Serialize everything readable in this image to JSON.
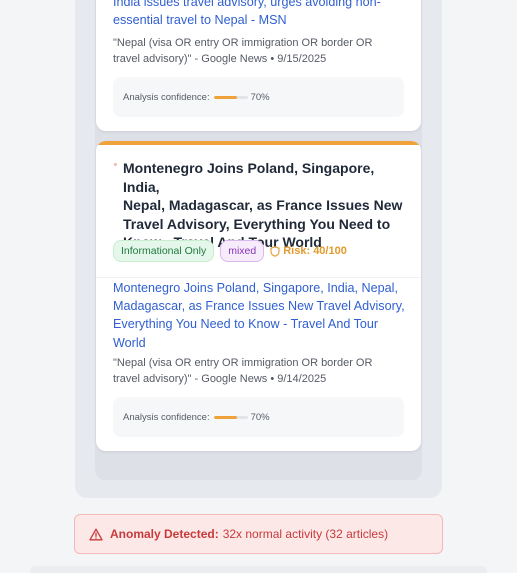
{
  "card1": {
    "link": "India issues travel advisory, urges avoiding non-essential travel to Nepal - MSN",
    "link_line1": "India issues travel advisory, urges avoiding non-",
    "link_line2": "essential travel to Nepal - MSN",
    "source_line1": "\"Nepal (visa OR entry OR immigration OR border OR",
    "source_line2": "travel advisory)\" - Google News • 9/15/2025",
    "confidence_label": "Analysis confidence:",
    "confidence_value": "70%",
    "confidence_fraction": 0.7
  },
  "card2": {
    "title_line1": "Montenegro Joins Poland, Singapore, India,",
    "title_line2": "Nepal, Madagascar, as France Issues New",
    "title_line3": "Travel Advisory, Everything You Need to",
    "title_line4": "Know - Travel And Tour World",
    "badge_category": "Informational Only",
    "badge_sentiment": "mixed",
    "risk": "Risk: 40/100",
    "link_line1": "Montenegro Joins Poland, Singapore, India, Nepal,",
    "link_line2": "Madagascar, as France Issues New Travel Advisory,",
    "link_line3": "Everything You Need to Know - Travel And Tour",
    "link_line4": "World",
    "source_line1": "\"Nepal (visa OR entry OR immigration OR border OR",
    "source_line2": "travel advisory)\" - Google News • 9/14/2025",
    "confidence_label": "Analysis confidence:",
    "confidence_value": "70%",
    "confidence_fraction": 0.7,
    "accent_color": "#f0a23a"
  },
  "anomaly": {
    "label": "Anomaly Detected:",
    "message": "32x normal activity (32 articles)",
    "icon": "warning-triangle-icon"
  }
}
